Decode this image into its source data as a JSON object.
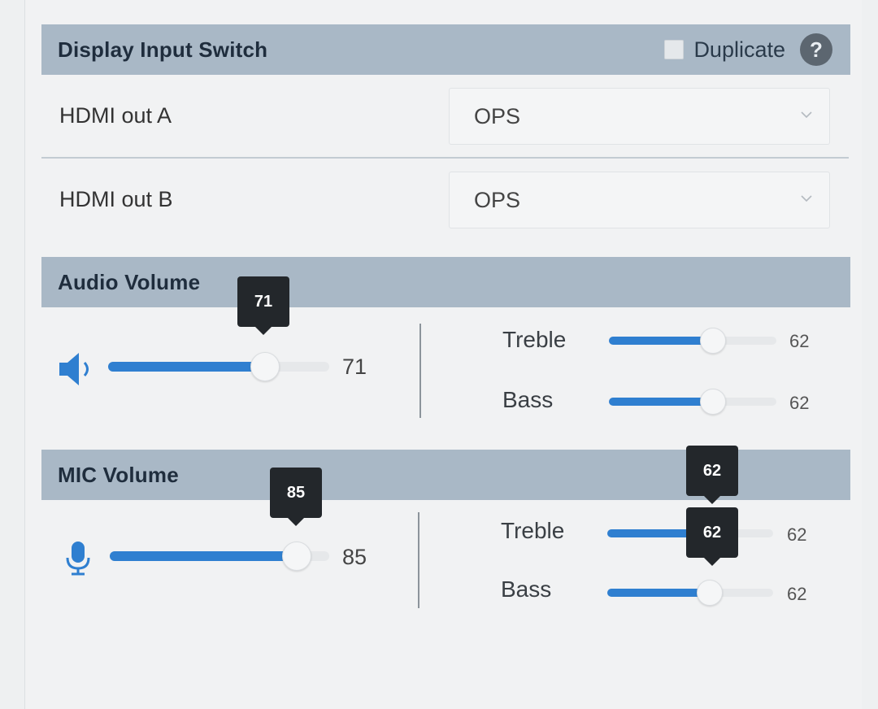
{
  "display_input_switch": {
    "title": "Display Input Switch",
    "duplicate_label": "Duplicate",
    "help_glyph": "?",
    "rows": [
      {
        "label": "HDMI out A",
        "value": "OPS"
      },
      {
        "label": "HDMI out B",
        "value": "OPS"
      }
    ]
  },
  "audio_volume": {
    "title": "Audio Volume",
    "icon": "speaker-icon",
    "volume": 71,
    "volume_max": 100,
    "volume_label": "71",
    "tooltip": "71",
    "treble": {
      "label": "Treble",
      "value": 62,
      "value_label": "62"
    },
    "bass": {
      "label": "Bass",
      "value": 62,
      "value_label": "62"
    }
  },
  "mic_volume": {
    "title": "MIC Volume",
    "icon": "microphone-icon",
    "volume": 85,
    "volume_max": 100,
    "volume_label": "85",
    "tooltip": "85",
    "treble": {
      "label": "Treble",
      "value": 62,
      "value_label": "62",
      "tooltip": "62"
    },
    "bass": {
      "label": "Bass",
      "value": 62,
      "value_label": "62",
      "tooltip": "62"
    }
  },
  "colors": {
    "accent": "#2f7fd0",
    "header_bg": "#a9b8c6",
    "tooltip_bg": "#23272b",
    "help_icon_bg": "#5c6670"
  }
}
